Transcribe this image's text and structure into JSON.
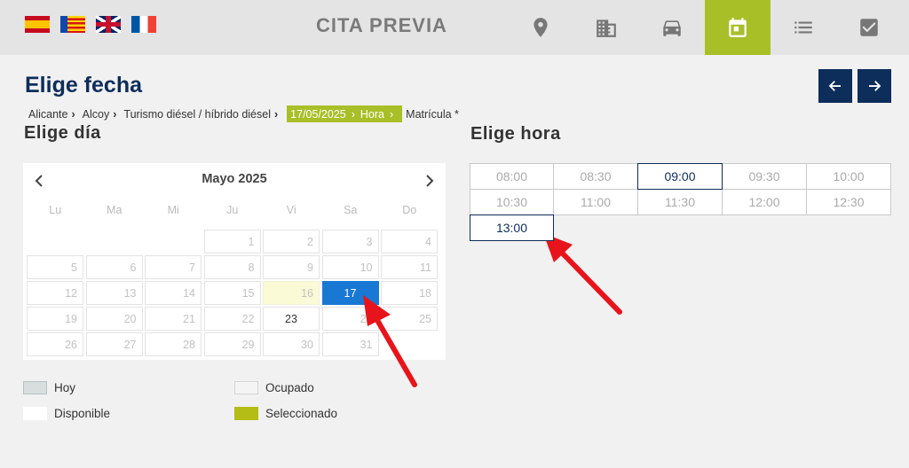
{
  "header": {
    "app_title": "CITA PREVIA",
    "flags": [
      "flag-es",
      "flag-valencia",
      "flag-uk",
      "flag-fr"
    ],
    "steps": [
      {
        "icon": "location-pin-icon",
        "active": false
      },
      {
        "icon": "building-icon",
        "active": false
      },
      {
        "icon": "car-icon",
        "active": false
      },
      {
        "icon": "calendar-icon",
        "active": true
      },
      {
        "icon": "list-icon",
        "active": false
      },
      {
        "icon": "checkbox-icon",
        "active": false
      }
    ],
    "active_color": "#a9bf28"
  },
  "page": {
    "title": "Elige fecha",
    "nav": {
      "prev_icon": "arrow-left-icon",
      "next_icon": "arrow-right-icon"
    }
  },
  "breadcrumb": {
    "items": [
      "Alicante",
      "Alcoy",
      "Turismo diésel / híbrido diésel"
    ],
    "highlight": {
      "date": "17/05/2025",
      "hour": "Hora"
    },
    "last": "Matrícula *"
  },
  "calendar": {
    "section_title": "Elige día",
    "month_label": "Mayo 2025",
    "weekdays": [
      "Lu",
      "Ma",
      "Mi",
      "Ju",
      "Vi",
      "Sa",
      "Do"
    ],
    "leading_empty": 3,
    "days": [
      "1",
      "2",
      "3",
      "4",
      "5",
      "6",
      "7",
      "8",
      "9",
      "10",
      "11",
      "12",
      "13",
      "14",
      "15",
      "16",
      "17",
      "18",
      "19",
      "20",
      "21",
      "22",
      "23",
      "24",
      "25",
      "26",
      "27",
      "28",
      "29",
      "30",
      "31"
    ],
    "today": "16",
    "selected": "17",
    "available": [
      "23"
    ],
    "selected_color": "#1878d4"
  },
  "legend": {
    "today": "Hoy",
    "busy": "Ocupado",
    "available": "Disponible",
    "selected": "Seleccionado"
  },
  "times": {
    "section_title": "Elige hora",
    "slots": [
      "08:00",
      "08:30",
      "09:00",
      "09:30",
      "10:00",
      "10:30",
      "11:00",
      "11:30",
      "12:00",
      "12:30",
      "13:00"
    ],
    "available": [
      "09:00",
      "13:00"
    ]
  }
}
